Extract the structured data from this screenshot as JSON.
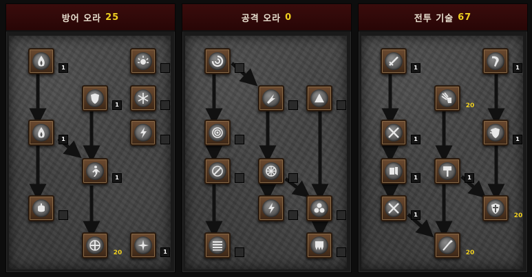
{
  "panels": [
    {
      "title": "방어 오라",
      "points": "25",
      "skills": [
        {
          "id": "p0s0",
          "icon": "flame-icon",
          "level": "1"
        },
        {
          "id": "p0s1",
          "icon": "sun-icon",
          "level": ""
        },
        {
          "id": "p0s2",
          "icon": "shield-icon",
          "level": "1"
        },
        {
          "id": "p0s3",
          "icon": "snowflake-icon",
          "level": ""
        },
        {
          "id": "p0s4",
          "icon": "flame-icon",
          "level": "1"
        },
        {
          "id": "p0s5",
          "icon": "lightning-icon",
          "level": ""
        },
        {
          "id": "p0s6",
          "icon": "runner-icon",
          "level": "1"
        },
        {
          "id": "p0s7",
          "icon": "fist-icon",
          "level": ""
        },
        {
          "id": "p0s8",
          "icon": "cross-icon",
          "level": "20"
        },
        {
          "id": "p0s9",
          "icon": "star-icon",
          "level": "1"
        }
      ]
    },
    {
      "title": "공격 오라",
      "points": "0",
      "skills": [
        {
          "id": "p1s0",
          "icon": "swirl-icon",
          "level": ""
        },
        {
          "id": "p1s1",
          "icon": "fire-bolt-icon",
          "level": ""
        },
        {
          "id": "p1s2",
          "icon": "triangle-icon",
          "level": ""
        },
        {
          "id": "p1s3",
          "icon": "target-icon",
          "level": ""
        },
        {
          "id": "p1s4",
          "icon": "slash-icon",
          "level": ""
        },
        {
          "id": "p1s5",
          "icon": "wheel-icon",
          "level": ""
        },
        {
          "id": "p1s6",
          "icon": "lightning-icon",
          "level": ""
        },
        {
          "id": "p1s7",
          "icon": "clover-icon",
          "level": ""
        },
        {
          "id": "p1s8",
          "icon": "bars-icon",
          "level": ""
        },
        {
          "id": "p1s9",
          "icon": "tooth-icon",
          "level": ""
        }
      ]
    },
    {
      "title": "전투 기술",
      "points": "67",
      "skills": [
        {
          "id": "p2s0",
          "icon": "sword-icon",
          "level": "1"
        },
        {
          "id": "p2s1",
          "icon": "charge-icon",
          "level": "1"
        },
        {
          "id": "p2s2",
          "icon": "bolt-hand-icon",
          "level": "20"
        },
        {
          "id": "p2s3",
          "icon": "crossed-swords-icon",
          "level": "1"
        },
        {
          "id": "p2s4",
          "icon": "holy-shield-icon",
          "level": "1"
        },
        {
          "id": "p2s5",
          "icon": "smite-icon",
          "level": "1"
        },
        {
          "id": "p2s6",
          "icon": "hammer-icon",
          "level": "1"
        },
        {
          "id": "p2s7",
          "icon": "crossed-swords-icon",
          "level": "1"
        },
        {
          "id": "p2s8",
          "icon": "cross-shield-icon",
          "level": "20"
        },
        {
          "id": "p2s9",
          "icon": "spear-icon",
          "level": "20"
        }
      ]
    }
  ]
}
